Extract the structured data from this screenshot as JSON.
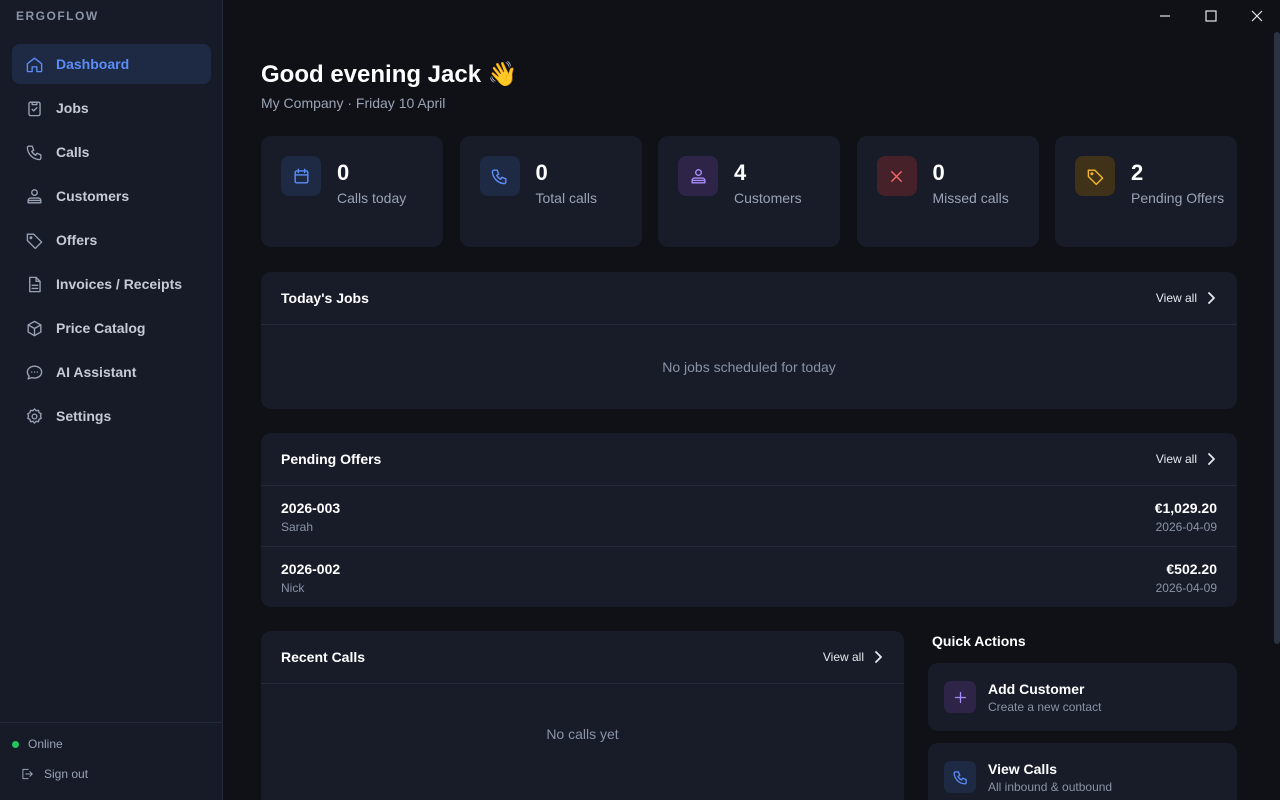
{
  "app": {
    "brand": "ERGOFLOW"
  },
  "sidebar": {
    "items": [
      {
        "label": "Dashboard",
        "icon": "home-icon",
        "active": true
      },
      {
        "label": "Jobs",
        "icon": "clipboard-icon"
      },
      {
        "label": "Calls",
        "icon": "phone-icon"
      },
      {
        "label": "Customers",
        "icon": "users-icon"
      },
      {
        "label": "Offers",
        "icon": "tag-icon"
      },
      {
        "label": "Invoices / Receipts",
        "icon": "document-icon"
      },
      {
        "label": "Price Catalog",
        "icon": "box-icon"
      },
      {
        "label": "AI Assistant",
        "icon": "chat-icon"
      },
      {
        "label": "Settings",
        "icon": "gear-icon"
      }
    ],
    "status": "Online",
    "signout": "Sign out"
  },
  "header": {
    "greeting": "Good evening Jack 👋",
    "subline": "My Company · Friday 10 April"
  },
  "stats": [
    {
      "value": "0",
      "label": "Calls today",
      "icon": "calendar-icon",
      "color": "#5b8df7"
    },
    {
      "value": "0",
      "label": "Total calls",
      "icon": "phone-icon",
      "color": "#5b8df7"
    },
    {
      "value": "4",
      "label": "Customers",
      "icon": "users-icon",
      "color": "#a78bfa"
    },
    {
      "value": "0",
      "label": "Missed calls",
      "icon": "close-icon",
      "color": "#f26565"
    },
    {
      "value": "2",
      "label": "Pending Offers",
      "icon": "tag-icon",
      "color": "#f2b82c"
    }
  ],
  "todays_jobs": {
    "title": "Today's Jobs",
    "view_all": "View all",
    "empty": "No jobs scheduled for today"
  },
  "pending_offers": {
    "title": "Pending Offers",
    "view_all": "View all",
    "rows": [
      {
        "id": "2026-003",
        "name": "Sarah",
        "amount": "€1,029.20",
        "date": "2026-04-09"
      },
      {
        "id": "2026-002",
        "name": "Nick",
        "amount": "€502.20",
        "date": "2026-04-09"
      }
    ]
  },
  "recent_calls": {
    "title": "Recent Calls",
    "view_all": "View all",
    "empty": "No calls yet"
  },
  "quick_actions": {
    "title": "Quick Actions",
    "items": [
      {
        "title": "Add Customer",
        "subtitle": "Create a new contact",
        "icon": "plus-icon",
        "color": "#a78bfa"
      },
      {
        "title": "View Calls",
        "subtitle": "All inbound & outbound",
        "icon": "phone-icon",
        "color": "#5b8df7"
      }
    ]
  }
}
